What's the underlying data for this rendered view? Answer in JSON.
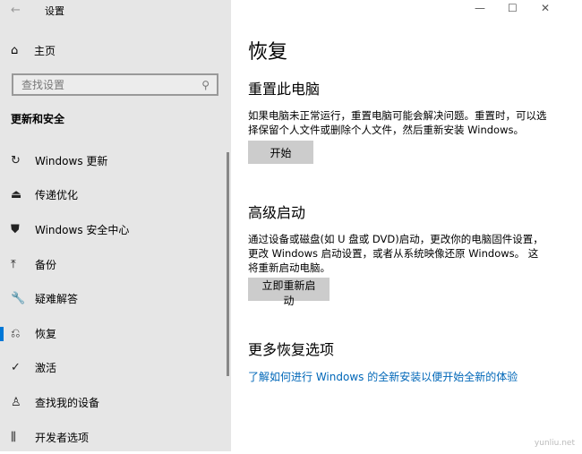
{
  "window": {
    "title": "设置",
    "back_icon": "back-arrow-icon",
    "minimize": "—",
    "maximize": "☐",
    "close": "✕"
  },
  "sidebar": {
    "home": "主页",
    "search_placeholder": "查找设置",
    "section": "更新和安全",
    "items": [
      {
        "label": "Windows 更新",
        "icon": "↻"
      },
      {
        "label": "传递优化",
        "icon": "⏏"
      },
      {
        "label": "Windows 安全中心",
        "icon": "⛊"
      },
      {
        "label": "备份",
        "icon": "⤒"
      },
      {
        "label": "疑难解答",
        "icon": "🔧"
      },
      {
        "label": "恢复",
        "icon": "⎌",
        "active": true
      },
      {
        "label": "激活",
        "icon": "✓"
      },
      {
        "label": "查找我的设备",
        "icon": "♙"
      },
      {
        "label": "开发者选项",
        "icon": "⫼"
      }
    ]
  },
  "main": {
    "title": "恢复",
    "reset": {
      "heading": "重置此电脑",
      "desc": "如果电脑未正常运行，重置电脑可能会解决问题。重置时，可以选择保留个人文件或删除个人文件，然后重新安装 Windows。",
      "button": "开始"
    },
    "advanced": {
      "heading": "高级启动",
      "desc": "通过设备或磁盘(如 U 盘或 DVD)启动，更改你的电脑固件设置，更改 Windows 启动设置，或者从系统映像还原 Windows。 这将重新启动电脑。",
      "button": "立即重新启动"
    },
    "more": {
      "heading": "更多恢复选项",
      "link": "了解如何进行 Windows 的全新安装以便开始全新的体验"
    }
  },
  "watermark": "yunliu.net",
  "colors": {
    "accent": "#0078d7",
    "link": "#0067b8",
    "sidebar": "#e6e6e6"
  }
}
